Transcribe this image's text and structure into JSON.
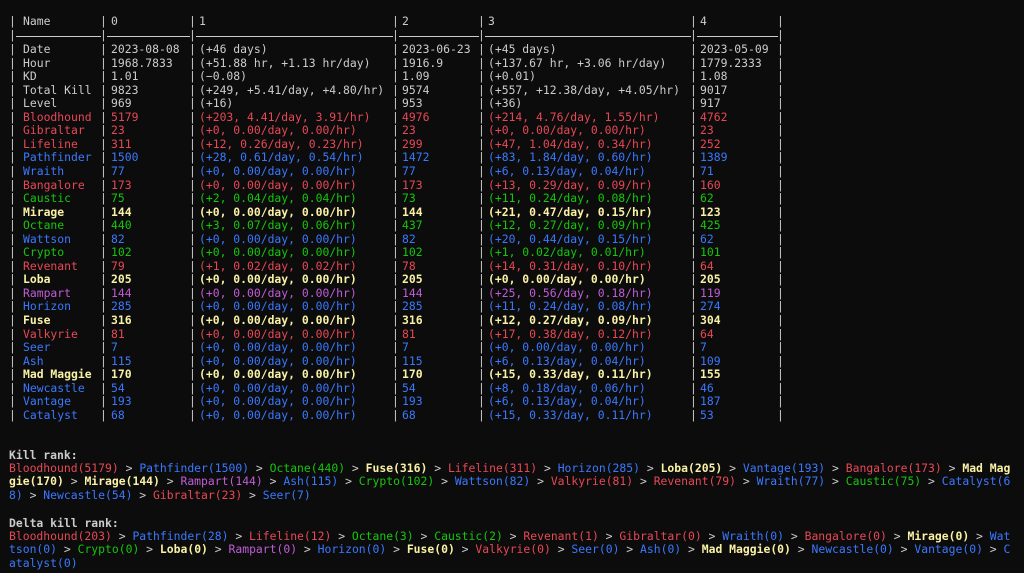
{
  "colors": {
    "default": "#cccccc",
    "red": "#e74856",
    "blue": "#3b78ff",
    "green": "#16c60c",
    "cyan": "#61d6d6",
    "yellow": "#f9f1a5",
    "magenta": "#b4009e",
    "purple": "#c05cd8"
  },
  "headers": [
    "Name",
    "0",
    "1",
    "2",
    "3",
    "4"
  ],
  "rows": [
    {
      "name": "Date",
      "color": "default",
      "bold": false,
      "c0": "2023-08-08",
      "c1": "(+46 days)",
      "c2": "2023-06-23",
      "c3": "(+45 days)",
      "c4": "2023-05-09"
    },
    {
      "name": "Hour",
      "color": "default",
      "bold": false,
      "c0": "1968.7833",
      "c1": "(+51.88 hr, +1.13 hr/day)",
      "c2": "1916.9",
      "c3": "(+137.67 hr, +3.06 hr/day)",
      "c4": "1779.2333"
    },
    {
      "name": "KD",
      "color": "default",
      "bold": false,
      "c0": "1.01",
      "c1": "(−0.08)",
      "c2": "1.09",
      "c3": "(+0.01)",
      "c4": "1.08"
    },
    {
      "name": "Total Kill",
      "color": "default",
      "bold": false,
      "c0": "9823",
      "c1": "(+249, +5.41/day, +4.80/hr)",
      "c2": "9574",
      "c3": "(+557, +12.38/day, +4.05/hr)",
      "c4": "9017"
    },
    {
      "name": "Level",
      "color": "default",
      "bold": false,
      "c0": "969",
      "c1": "(+16)",
      "c2": "953",
      "c3": "(+36)",
      "c4": "917"
    },
    {
      "name": "Bloodhound",
      "color": "red",
      "bold": false,
      "c0": "5179",
      "c1": "(+203, 4.41/day, 3.91/hr)",
      "c2": "4976",
      "c3": "(+214, 4.76/day, 1.55/hr)",
      "c4": "4762"
    },
    {
      "name": "Gibraltar",
      "color": "red",
      "bold": false,
      "c0": "23",
      "c1": "(+0, 0.00/day, 0.00/hr)",
      "c2": "23",
      "c3": "(+0, 0.00/day, 0.00/hr)",
      "c4": "23"
    },
    {
      "name": "Lifeline",
      "color": "red",
      "bold": false,
      "c0": "311",
      "c1": "(+12, 0.26/day, 0.23/hr)",
      "c2": "299",
      "c3": "(+47, 1.04/day, 0.34/hr)",
      "c4": "252"
    },
    {
      "name": "Pathfinder",
      "color": "blue",
      "bold": false,
      "c0": "1500",
      "c1": "(+28, 0.61/day, 0.54/hr)",
      "c2": "1472",
      "c3": "(+83, 1.84/day, 0.60/hr)",
      "c4": "1389"
    },
    {
      "name": "Wraith",
      "color": "blue",
      "bold": false,
      "c0": "77",
      "c1": "(+0, 0.00/day, 0.00/hr)",
      "c2": "77",
      "c3": "(+6, 0.13/day, 0.04/hr)",
      "c4": "71"
    },
    {
      "name": "Bangalore",
      "color": "red",
      "bold": false,
      "c0": "173",
      "c1": "(+0, 0.00/day, 0.00/hr)",
      "c2": "173",
      "c3": "(+13, 0.29/day, 0.09/hr)",
      "c4": "160"
    },
    {
      "name": "Caustic",
      "color": "green",
      "bold": false,
      "c0": "75",
      "c1": "(+2, 0.04/day, 0.04/hr)",
      "c2": "73",
      "c3": "(+11, 0.24/day, 0.08/hr)",
      "c4": "62"
    },
    {
      "name": "Mirage",
      "color": "yellow",
      "bold": true,
      "c0": "144",
      "c1": "(+0, 0.00/day, 0.00/hr)",
      "c2": "144",
      "c3": "(+21, 0.47/day, 0.15/hr)",
      "c4": "123"
    },
    {
      "name": "Octane",
      "color": "green",
      "bold": false,
      "c0": "440",
      "c1": "(+3, 0.07/day, 0.06/hr)",
      "c2": "437",
      "c3": "(+12, 0.27/day, 0.09/hr)",
      "c4": "425"
    },
    {
      "name": "Wattson",
      "color": "blue",
      "bold": false,
      "c0": "82",
      "c1": "(+0, 0.00/day, 0.00/hr)",
      "c2": "82",
      "c3": "(+20, 0.44/day, 0.15/hr)",
      "c4": "62"
    },
    {
      "name": "Crypto",
      "color": "green",
      "bold": false,
      "c0": "102",
      "c1": "(+0, 0.00/day, 0.00/hr)",
      "c2": "102",
      "c3": "(+1, 0.02/day, 0.01/hr)",
      "c4": "101"
    },
    {
      "name": "Revenant",
      "color": "red",
      "bold": false,
      "c0": "79",
      "c1": "(+1, 0.02/day, 0.02/hr)",
      "c2": "78",
      "c3": "(+14, 0.31/day, 0.10/hr)",
      "c4": "64"
    },
    {
      "name": "Loba",
      "color": "yellow",
      "bold": true,
      "c0": "205",
      "c1": "(+0, 0.00/day, 0.00/hr)",
      "c2": "205",
      "c3": "(+0, 0.00/day, 0.00/hr)",
      "c4": "205"
    },
    {
      "name": "Rampart",
      "color": "purple",
      "bold": false,
      "c0": "144",
      "c1": "(+0, 0.00/day, 0.00/hr)",
      "c2": "144",
      "c3": "(+25, 0.56/day, 0.18/hr)",
      "c4": "119"
    },
    {
      "name": "Horizon",
      "color": "blue",
      "bold": false,
      "c0": "285",
      "c1": "(+0, 0.00/day, 0.00/hr)",
      "c2": "285",
      "c3": "(+11, 0.24/day, 0.08/hr)",
      "c4": "274"
    },
    {
      "name": "Fuse",
      "color": "yellow",
      "bold": true,
      "c0": "316",
      "c1": "(+0, 0.00/day, 0.00/hr)",
      "c2": "316",
      "c3": "(+12, 0.27/day, 0.09/hr)",
      "c4": "304"
    },
    {
      "name": "Valkyrie",
      "color": "red",
      "bold": false,
      "c0": "81",
      "c1": "(+0, 0.00/day, 0.00/hr)",
      "c2": "81",
      "c3": "(+17, 0.38/day, 0.12/hr)",
      "c4": "64"
    },
    {
      "name": "Seer",
      "color": "blue",
      "bold": false,
      "c0": "7",
      "c1": "(+0, 0.00/day, 0.00/hr)",
      "c2": "7",
      "c3": "(+0, 0.00/day, 0.00/hr)",
      "c4": "7"
    },
    {
      "name": "Ash",
      "color": "blue",
      "bold": false,
      "c0": "115",
      "c1": "(+0, 0.00/day, 0.00/hr)",
      "c2": "115",
      "c3": "(+6, 0.13/day, 0.04/hr)",
      "c4": "109"
    },
    {
      "name": "Mad Maggie",
      "color": "yellow",
      "bold": true,
      "c0": "170",
      "c1": "(+0, 0.00/day, 0.00/hr)",
      "c2": "170",
      "c3": "(+15, 0.33/day, 0.11/hr)",
      "c4": "155"
    },
    {
      "name": "Newcastle",
      "color": "blue",
      "bold": false,
      "c0": "54",
      "c1": "(+0, 0.00/day, 0.00/hr)",
      "c2": "54",
      "c3": "(+8, 0.18/day, 0.06/hr)",
      "c4": "46"
    },
    {
      "name": "Vantage",
      "color": "blue",
      "bold": false,
      "c0": "193",
      "c1": "(+0, 0.00/day, 0.00/hr)",
      "c2": "193",
      "c3": "(+6, 0.13/day, 0.04/hr)",
      "c4": "187"
    },
    {
      "name": "Catalyst",
      "color": "blue",
      "bold": false,
      "c0": "68",
      "c1": "(+0, 0.00/day, 0.00/hr)",
      "c2": "68",
      "c3": "(+15, 0.33/day, 0.11/hr)",
      "c4": "53"
    }
  ],
  "kill_rank": {
    "label": "Kill rank:",
    "separator": " > ",
    "items": [
      {
        "text": "Bloodhound(5179)",
        "color": "red",
        "bold": false
      },
      {
        "text": "Pathfinder(1500)",
        "color": "blue",
        "bold": false
      },
      {
        "text": "Octane(440)",
        "color": "green",
        "bold": false
      },
      {
        "text": "Fuse(316)",
        "color": "yellow",
        "bold": true
      },
      {
        "text": "Lifeline(311)",
        "color": "red",
        "bold": false
      },
      {
        "text": "Horizon(285)",
        "color": "blue",
        "bold": false
      },
      {
        "text": "Loba(205)",
        "color": "yellow",
        "bold": true
      },
      {
        "text": "Vantage(193)",
        "color": "blue",
        "bold": false
      },
      {
        "text": "Bangalore(173)",
        "color": "red",
        "bold": false
      },
      {
        "text": "Mad Maggie(170)",
        "color": "yellow",
        "bold": true
      },
      {
        "text": "Mirage(144)",
        "color": "yellow",
        "bold": true
      },
      {
        "text": "Rampart(144)",
        "color": "purple",
        "bold": false
      },
      {
        "text": "Ash(115)",
        "color": "blue",
        "bold": false
      },
      {
        "text": "Crypto(102)",
        "color": "green",
        "bold": false
      },
      {
        "text": "Wattson(82)",
        "color": "blue",
        "bold": false
      },
      {
        "text": "Valkyrie(81)",
        "color": "red",
        "bold": false
      },
      {
        "text": "Revenant(79)",
        "color": "red",
        "bold": false
      },
      {
        "text": "Wraith(77)",
        "color": "blue",
        "bold": false
      },
      {
        "text": "Caustic(75)",
        "color": "green",
        "bold": false
      },
      {
        "text": "Catalyst(68)",
        "color": "blue",
        "bold": false
      },
      {
        "text": "Newcastle(54)",
        "color": "blue",
        "bold": false
      },
      {
        "text": "Gibraltar(23)",
        "color": "red",
        "bold": false
      },
      {
        "text": "Seer(7)",
        "color": "blue",
        "bold": false
      }
    ]
  },
  "delta_kill_rank": {
    "label": "Delta kill rank:",
    "separator": " > ",
    "items": [
      {
        "text": "Bloodhound(203)",
        "color": "red",
        "bold": false
      },
      {
        "text": "Pathfinder(28)",
        "color": "blue",
        "bold": false
      },
      {
        "text": "Lifeline(12)",
        "color": "red",
        "bold": false
      },
      {
        "text": "Octane(3)",
        "color": "green",
        "bold": false
      },
      {
        "text": "Caustic(2)",
        "color": "green",
        "bold": false
      },
      {
        "text": "Revenant(1)",
        "color": "red",
        "bold": false
      },
      {
        "text": "Gibraltar(0)",
        "color": "red",
        "bold": false
      },
      {
        "text": "Wraith(0)",
        "color": "blue",
        "bold": false
      },
      {
        "text": "Bangalore(0)",
        "color": "red",
        "bold": false
      },
      {
        "text": "Mirage(0)",
        "color": "yellow",
        "bold": true
      },
      {
        "text": "Wattson(0)",
        "color": "blue",
        "bold": false
      },
      {
        "text": "Crypto(0)",
        "color": "green",
        "bold": false
      },
      {
        "text": "Loba(0)",
        "color": "yellow",
        "bold": true
      },
      {
        "text": "Rampart(0)",
        "color": "purple",
        "bold": false
      },
      {
        "text": "Horizon(0)",
        "color": "blue",
        "bold": false
      },
      {
        "text": "Fuse(0)",
        "color": "yellow",
        "bold": true
      },
      {
        "text": "Valkyrie(0)",
        "color": "red",
        "bold": false
      },
      {
        "text": "Seer(0)",
        "color": "blue",
        "bold": false
      },
      {
        "text": "Ash(0)",
        "color": "blue",
        "bold": false
      },
      {
        "text": "Mad Maggie(0)",
        "color": "yellow",
        "bold": true
      },
      {
        "text": "Newcastle(0)",
        "color": "blue",
        "bold": false
      },
      {
        "text": "Vantage(0)",
        "color": "blue",
        "bold": false
      },
      {
        "text": "Catalyst(0)",
        "color": "blue",
        "bold": false
      }
    ]
  }
}
